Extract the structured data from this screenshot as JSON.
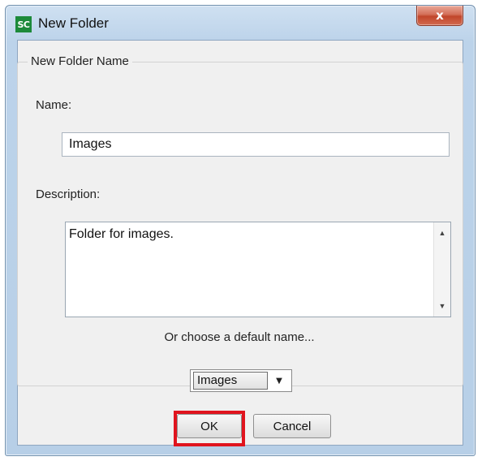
{
  "window": {
    "title": "New Folder",
    "app_logo_text": "SC",
    "close_glyph": "x"
  },
  "group": {
    "title": "New Folder Name"
  },
  "fields": {
    "name_label": "Name:",
    "name_value": "Images",
    "description_label": "Description:",
    "description_value": "Folder for images.",
    "default_name_label": "Or choose a default name...",
    "default_name_selected": "Images"
  },
  "buttons": {
    "ok_label": "OK",
    "cancel_label": "Cancel"
  },
  "colors": {
    "highlight": "#e0141e",
    "logo_green": "#1d8a3a",
    "close_red": "#c1462b"
  },
  "icons": {
    "close": "close-icon",
    "scroll_up": "scroll-up-arrow-icon",
    "scroll_down": "scroll-down-arrow-icon",
    "dropdown": "chevron-down-icon"
  }
}
